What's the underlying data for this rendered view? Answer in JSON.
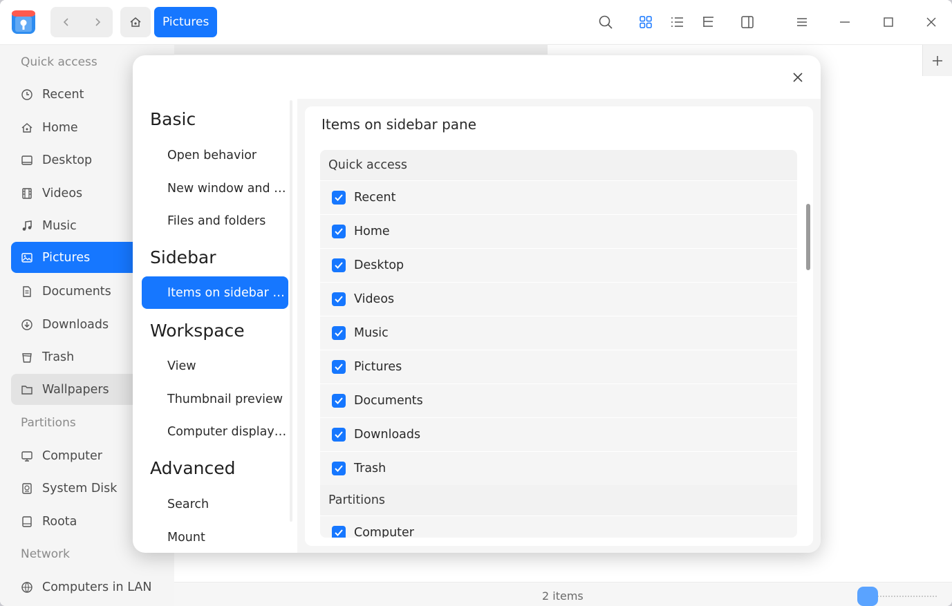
{
  "toolbar": {
    "breadcrumb": "Pictures",
    "icons": [
      "search-icon",
      "icon-view-icon",
      "list-view-icon",
      "tree-view-icon",
      "detail-pane-icon",
      "menu-icon",
      "minimize-icon",
      "maximize-icon",
      "close-icon"
    ]
  },
  "sidebar": {
    "quick_access_label": "Quick access",
    "quick_access": [
      {
        "label": "Recent",
        "icon": "clock-icon"
      },
      {
        "label": "Home",
        "icon": "home-icon"
      },
      {
        "label": "Desktop",
        "icon": "desktop-icon"
      },
      {
        "label": "Videos",
        "icon": "film-icon"
      },
      {
        "label": "Music",
        "icon": "music-icon"
      },
      {
        "label": "Pictures",
        "icon": "image-icon"
      },
      {
        "label": "Documents",
        "icon": "document-icon"
      },
      {
        "label": "Downloads",
        "icon": "download-icon"
      },
      {
        "label": "Trash",
        "icon": "trash-icon"
      },
      {
        "label": "Wallpapers",
        "icon": "folder-icon"
      }
    ],
    "partitions_label": "Partitions",
    "partitions": [
      {
        "label": "Computer",
        "icon": "computer-icon"
      },
      {
        "label": "System Disk",
        "icon": "disk-icon"
      },
      {
        "label": "Roota",
        "icon": "drive-icon"
      }
    ],
    "network_label": "Network",
    "network": [
      {
        "label": "Computers in LAN",
        "icon": "network-icon"
      }
    ]
  },
  "status": {
    "item_count": "2 items"
  },
  "settings_dialog": {
    "nav": {
      "basic": "Basic",
      "basic_items": [
        "Open behavior",
        "New window and …",
        "Files and folders"
      ],
      "sidebar": "Sidebar",
      "sidebar_items": [
        "Items on sidebar …"
      ],
      "workspace": "Workspace",
      "workspace_items": [
        "View",
        "Thumbnail preview",
        "Computer display…"
      ],
      "advanced": "Advanced",
      "advanced_items": [
        "Search",
        "Mount"
      ]
    },
    "panel_title": "Items on sidebar pane",
    "quick_access_header": "Quick access",
    "quick_access_items": [
      "Recent",
      "Home",
      "Desktop",
      "Videos",
      "Music",
      "Pictures",
      "Documents",
      "Downloads",
      "Trash"
    ],
    "partitions_header": "Partitions",
    "partitions_items": [
      "Computer"
    ],
    "checked": true
  },
  "colors": {
    "accent": "#1677ff",
    "sidebar_bg": "#f5f5f5"
  }
}
